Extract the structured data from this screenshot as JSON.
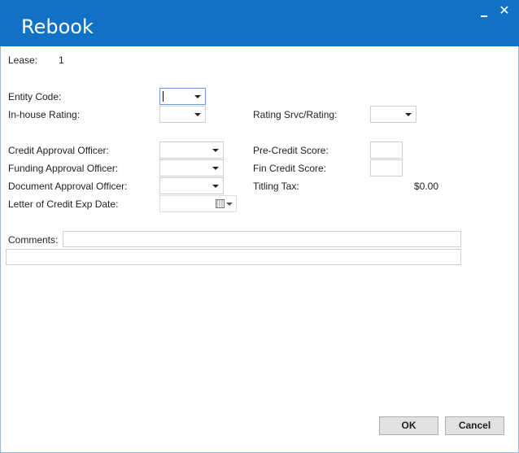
{
  "window": {
    "title": "Rebook",
    "minimize_icon": "minimize-icon",
    "close_icon": "close-icon",
    "close_glyph": "✕"
  },
  "lease": {
    "label": "Lease:",
    "value": "1"
  },
  "fields": {
    "entity_code": {
      "label": "Entity Code:",
      "value": ""
    },
    "inhouse_rating": {
      "label": "In-house Rating:",
      "value": ""
    },
    "rating_srvc": {
      "label": "Rating Srvc/Rating:",
      "value": ""
    },
    "credit_approval_officer": {
      "label": "Credit Approval Officer:",
      "value": ""
    },
    "funding_approval_officer": {
      "label": "Funding Approval Officer:",
      "value": ""
    },
    "document_approval_officer": {
      "label": "Document Approval Officer:",
      "value": ""
    },
    "letter_of_credit_exp_date": {
      "label": "Letter of Credit Exp Date:",
      "value": "",
      "icon": "calendar-icon"
    },
    "pre_credit_score": {
      "label": "Pre-Credit Score:",
      "value": ""
    },
    "fin_credit_score": {
      "label": "Fin Credit Score:",
      "value": ""
    },
    "titling_tax": {
      "label": "Titling Tax:",
      "value": "$0.00"
    },
    "comments": {
      "label": "Comments:",
      "value": "",
      "extra_value": ""
    }
  },
  "buttons": {
    "ok": "OK",
    "cancel": "Cancel"
  },
  "colors": {
    "titlebar": "#1172c5",
    "title_text": "#ffffff",
    "button_face": "#e1e1e1"
  }
}
